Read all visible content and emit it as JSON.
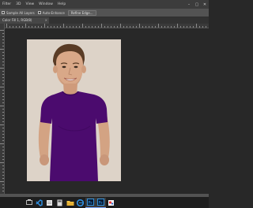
{
  "menubar": {
    "items": [
      "Filter",
      "3D",
      "View",
      "Window",
      "Help"
    ],
    "window_controls": [
      "–",
      "▢",
      "✕"
    ]
  },
  "options_bar": {
    "sample_all_layers_label": "Sample All Layers",
    "auto_enhance_label": "Auto-Enhance",
    "refine_edge_label": "Refine Edge..."
  },
  "document_tab": {
    "title": "Color Fill 1, RGB/8)",
    "close": "×"
  },
  "canvas": {
    "background_color": "#ddd3c8",
    "shirt_color": "#4b0b6e"
  },
  "taskbar": {
    "icons": [
      "task-view-icon",
      "visual-studio-code-icon",
      "notes-app-icon",
      "calculator-icon",
      "file-explorer-icon",
      "edge-browser-icon",
      "photoshop-icon",
      "photoshop-icon",
      "paint-icon"
    ]
  }
}
